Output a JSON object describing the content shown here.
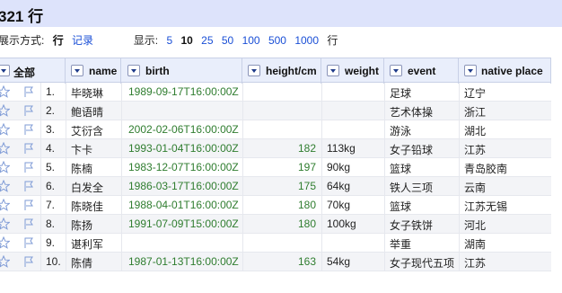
{
  "title": "321 行",
  "options": {
    "display_label": "展示方式:",
    "mode_current": "行",
    "mode_link": "记录",
    "show_label": "显示:",
    "page_sizes": [
      "5",
      "10",
      "25",
      "50",
      "100",
      "500",
      "1000"
    ],
    "page_size_current": "10",
    "unit": "行"
  },
  "columns": {
    "all": "全部",
    "name": "name",
    "birth": "birth",
    "height": "height/cm",
    "weight": "weight",
    "event": "event",
    "native": "native place"
  },
  "rows": [
    {
      "idx": "1.",
      "name": "毕晓琳",
      "birth": "1989-09-17T16:00:00Z",
      "height": "",
      "weight": "",
      "event": "足球",
      "native": "辽宁"
    },
    {
      "idx": "2.",
      "name": "鲍语晴",
      "birth": "",
      "height": "",
      "weight": "",
      "event": "艺术体操",
      "native": "浙江"
    },
    {
      "idx": "3.",
      "name": "艾衍含",
      "birth": "2002-02-06T16:00:00Z",
      "height": "",
      "weight": "",
      "event": "游泳",
      "native": "湖北"
    },
    {
      "idx": "4.",
      "name": "卞卡",
      "birth": "1993-01-04T16:00:00Z",
      "height": "182",
      "weight": "113kg",
      "event": "女子铅球",
      "native": "江苏"
    },
    {
      "idx": "5.",
      "name": "陈楠",
      "birth": "1983-12-07T16:00:00Z",
      "height": "197",
      "weight": "90kg",
      "event": "篮球",
      "native": "青岛胶南"
    },
    {
      "idx": "6.",
      "name": "白发全",
      "birth": "1986-03-17T16:00:00Z",
      "height": "175",
      "weight": "64kg",
      "event": "铁人三项",
      "native": "云南"
    },
    {
      "idx": "7.",
      "name": "陈晓佳",
      "birth": "1988-04-01T16:00:00Z",
      "height": "180",
      "weight": "70kg",
      "event": "篮球",
      "native": "江苏无锡"
    },
    {
      "idx": "8.",
      "name": "陈扬",
      "birth": "1991-07-09T15:00:00Z",
      "height": "180",
      "weight": "100kg",
      "event": "女子铁饼",
      "native": "河北"
    },
    {
      "idx": "9.",
      "name": "谌利军",
      "birth": "",
      "height": "",
      "weight": "",
      "event": "举重",
      "native": "湖南"
    },
    {
      "idx": "10.",
      "name": "陈倩",
      "birth": "1987-01-13T16:00:00Z",
      "height": "163",
      "weight": "54kg",
      "event": "女子现代五项",
      "native": "江苏"
    }
  ]
}
